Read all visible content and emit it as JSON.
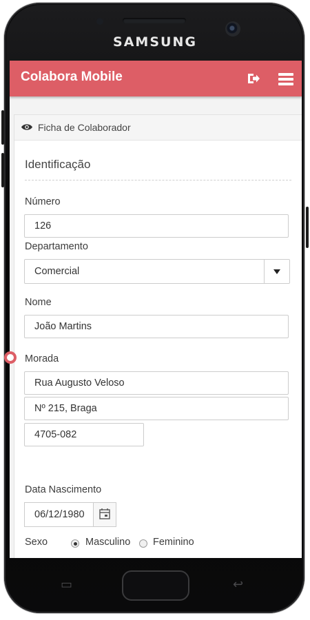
{
  "device": {
    "brand": "SAMSUNG"
  },
  "app": {
    "title": "Colabora Mobile"
  },
  "panel": {
    "title": "Ficha de Colaborador"
  },
  "form": {
    "section_title": "Identificação",
    "numero": {
      "label": "Número",
      "value": "126"
    },
    "departamento": {
      "label": "Departamento",
      "value": "Comercial"
    },
    "nome": {
      "label": "Nome",
      "value": "João Martins"
    },
    "morada": {
      "label": "Morada",
      "line1": "Rua Augusto Veloso",
      "line2": "Nº 215, Braga",
      "postal": "4705-082"
    },
    "data_nascimento": {
      "label": "Data Nascimento",
      "value": "06/12/1980"
    },
    "sexo": {
      "label": "Sexo",
      "options": [
        "Masculino",
        "Feminino"
      ],
      "selected": "Masculino"
    }
  },
  "colors": {
    "accent": "#dd5e66"
  }
}
